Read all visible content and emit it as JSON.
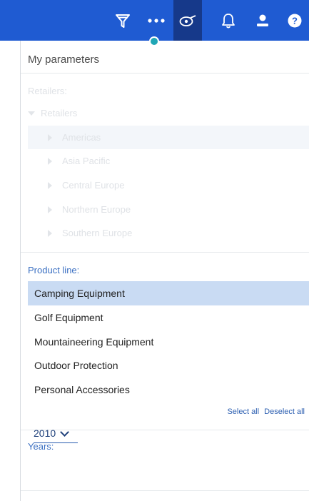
{
  "topbar": {
    "icons": [
      "filter-icon",
      "more-icon",
      "watch-icon",
      "bell-icon",
      "user-icon",
      "help-icon"
    ],
    "help_glyph": "?",
    "bg": "#1f5bd2",
    "active_bg": "#16398a",
    "indicator_color": "#1fa6b5"
  },
  "panel": {
    "title": "My parameters",
    "retailers": {
      "label": "Retailers:",
      "root": "Retailers",
      "children": [
        "Americas",
        "Asia Pacific",
        "Central Europe",
        "Northern Europe",
        "Southern Europe"
      ]
    },
    "product_line": {
      "label": "Product line:",
      "items": [
        "Camping Equipment",
        "Golf Equipment",
        "Mountaineering Equipment",
        "Outdoor Protection",
        "Personal Accessories"
      ],
      "selected": "Camping Equipment",
      "select_all": "Select all",
      "deselect_all": "Deselect all"
    },
    "years": {
      "label": "Years:",
      "value": "2010"
    }
  }
}
